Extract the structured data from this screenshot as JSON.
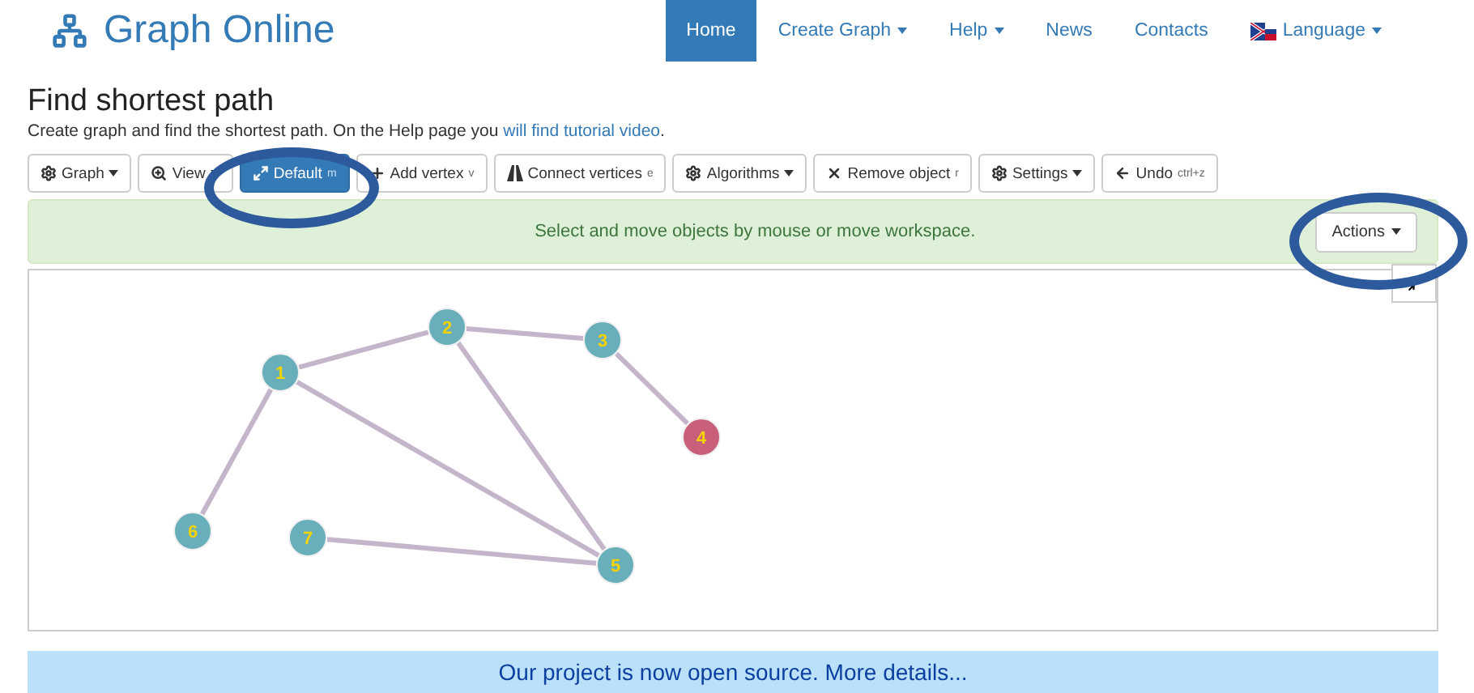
{
  "brand": "Graph Online",
  "nav": [
    {
      "label": "Home",
      "selected": true,
      "dropdown": false,
      "kind": "link"
    },
    {
      "label": "Create Graph",
      "selected": false,
      "dropdown": true,
      "kind": "link"
    },
    {
      "label": "Help",
      "selected": false,
      "dropdown": true,
      "kind": "link"
    },
    {
      "label": "News",
      "selected": false,
      "dropdown": false,
      "kind": "link"
    },
    {
      "label": "Contacts",
      "selected": false,
      "dropdown": false,
      "kind": "link"
    },
    {
      "label": "Language",
      "selected": false,
      "dropdown": true,
      "kind": "flag"
    }
  ],
  "title": "Find shortest path",
  "subtitle": {
    "text": "Create graph and find the shortest path. On the Help page you ",
    "link": "will find tutorial video",
    "end": "."
  },
  "toolbar": [
    {
      "label": "Graph",
      "kind": "gear",
      "dropdown": true,
      "selected": false
    },
    {
      "label": "View",
      "kind": "zoom",
      "dropdown": true,
      "selected": false
    },
    {
      "label": "Default",
      "kind": "expand",
      "dropdown": false,
      "selected": true,
      "shortcut": "m"
    },
    {
      "label": "Add vertex",
      "kind": "plus",
      "dropdown": false,
      "selected": false,
      "shortcut": "v"
    },
    {
      "label": "Connect vertices",
      "kind": "road",
      "dropdown": false,
      "selected": false,
      "shortcut": "e"
    },
    {
      "label": "Algorithms",
      "kind": "gear",
      "dropdown": true,
      "selected": false
    },
    {
      "label": "Remove object",
      "kind": "x",
      "dropdown": false,
      "selected": false,
      "shortcut": "r"
    },
    {
      "label": "Settings",
      "kind": "gear",
      "dropdown": true,
      "selected": false
    },
    {
      "label": "Undo",
      "kind": "back",
      "dropdown": false,
      "selected": false,
      "shortcut": "ctrl+z"
    }
  ],
  "message": "Select and move objects by mouse or move workspace.",
  "actions_button": "Actions",
  "vertices": [
    {
      "label": "1",
      "color": "#68aebb"
    },
    {
      "label": "2",
      "color": "#68aebb"
    },
    {
      "label": "3",
      "color": "#68aebb"
    },
    {
      "label": "4",
      "color": "#c9607a"
    },
    {
      "label": "5",
      "color": "#68aebb"
    },
    {
      "label": "6",
      "color": "#68aebb"
    },
    {
      "label": "7",
      "color": "#68aebb"
    }
  ],
  "banner": "Our project is now open source. More details..."
}
